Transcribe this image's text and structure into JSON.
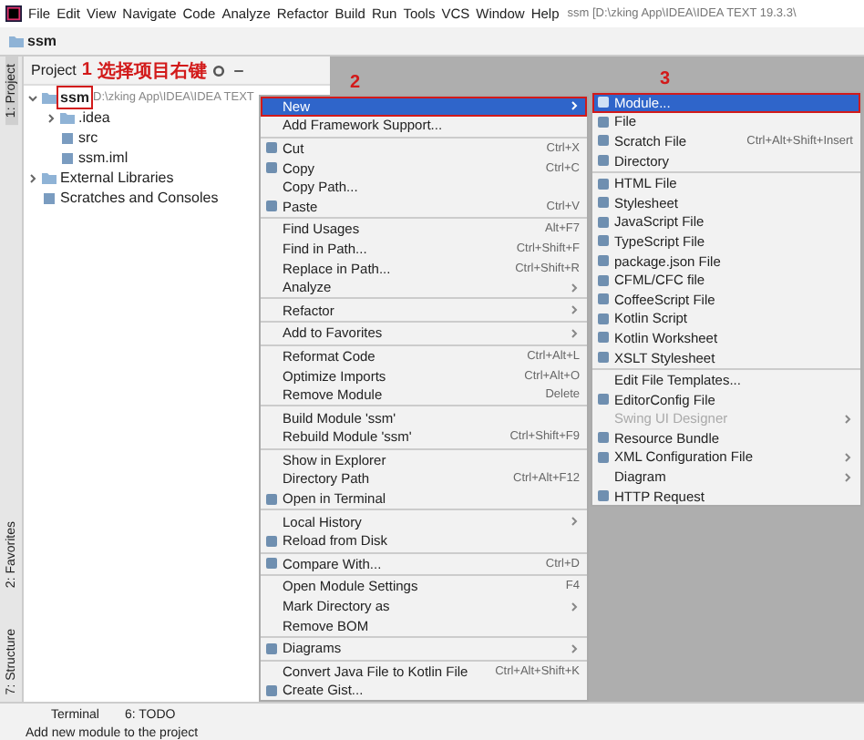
{
  "menu_bar": {
    "items": [
      "File",
      "Edit",
      "View",
      "Navigate",
      "Code",
      "Analyze",
      "Refactor",
      "Build",
      "Run",
      "Tools",
      "VCS",
      "Window",
      "Help"
    ],
    "title": "ssm [D:\\zking App\\IDEA\\IDEA TEXT 19.3.3\\"
  },
  "nav_bar": {
    "crumb": "ssm"
  },
  "side_tabs": {
    "top": [
      {
        "label": "1: Project",
        "selected": true
      }
    ],
    "bottom": [
      {
        "label": "2: Favorites",
        "selected": false
      },
      {
        "label": "7: Structure",
        "selected": false
      }
    ]
  },
  "project_panel": {
    "title": "Project",
    "tree": [
      {
        "label": "ssm",
        "path": "D:\\zking App\\IDEA\\IDEA TEXT",
        "expanded": true,
        "annotated": true,
        "children": [
          {
            "label": ".idea",
            "expanded": false
          },
          {
            "label": "src"
          },
          {
            "label": "ssm.iml"
          }
        ]
      },
      {
        "label": "External Libraries",
        "expanded": false
      },
      {
        "label": "Scratches and Consoles"
      }
    ]
  },
  "annotations": [
    {
      "label": "1",
      "note": "选择项目右键"
    },
    {
      "label": "2"
    },
    {
      "label": "3"
    }
  ],
  "context_menu": {
    "items": [
      {
        "kind": "item",
        "label": "New",
        "selected": true,
        "submenu": true,
        "annotated": true
      },
      {
        "kind": "item",
        "label": "Add Framework Support...",
        "selected": false
      },
      {
        "kind": "separator"
      },
      {
        "kind": "item",
        "label": "Cut",
        "shortcut": "Ctrl+X",
        "selected": false,
        "has_icon": true
      },
      {
        "kind": "item",
        "label": "Copy",
        "shortcut": "Ctrl+C",
        "selected": false,
        "has_icon": true
      },
      {
        "kind": "item",
        "label": "Copy Path...",
        "selected": false
      },
      {
        "kind": "item",
        "label": "Paste",
        "shortcut": "Ctrl+V",
        "selected": false,
        "has_icon": true
      },
      {
        "kind": "separator"
      },
      {
        "kind": "item",
        "label": "Find Usages",
        "shortcut": "Alt+F7",
        "selected": false
      },
      {
        "kind": "item",
        "label": "Find in Path...",
        "shortcut": "Ctrl+Shift+F",
        "selected": false
      },
      {
        "kind": "item",
        "label": "Replace in Path...",
        "shortcut": "Ctrl+Shift+R",
        "selected": false
      },
      {
        "kind": "item",
        "label": "Analyze",
        "selected": false,
        "submenu": true
      },
      {
        "kind": "separator"
      },
      {
        "kind": "item",
        "label": "Refactor",
        "selected": false,
        "submenu": true
      },
      {
        "kind": "separator"
      },
      {
        "kind": "item",
        "label": "Add to Favorites",
        "selected": false,
        "submenu": true
      },
      {
        "kind": "separator"
      },
      {
        "kind": "item",
        "label": "Reformat Code",
        "shortcut": "Ctrl+Alt+L",
        "selected": false
      },
      {
        "kind": "item",
        "label": "Optimize Imports",
        "shortcut": "Ctrl+Alt+O",
        "selected": false
      },
      {
        "kind": "item",
        "label": "Remove Module",
        "shortcut": "Delete",
        "selected": false
      },
      {
        "kind": "separator"
      },
      {
        "kind": "item",
        "label": "Build Module 'ssm'",
        "selected": false
      },
      {
        "kind": "item",
        "label": "Rebuild Module 'ssm'",
        "shortcut": "Ctrl+Shift+F9",
        "selected": false
      },
      {
        "kind": "separator"
      },
      {
        "kind": "item",
        "label": "Show in Explorer",
        "selected": false
      },
      {
        "kind": "item",
        "label": "Directory Path",
        "shortcut": "Ctrl+Alt+F12",
        "selected": false
      },
      {
        "kind": "item",
        "label": "Open in Terminal",
        "selected": false,
        "has_icon": true
      },
      {
        "kind": "separator"
      },
      {
        "kind": "item",
        "label": "Local History",
        "selected": false,
        "submenu": true
      },
      {
        "kind": "item",
        "label": "Reload from Disk",
        "selected": false,
        "has_icon": true
      },
      {
        "kind": "separator"
      },
      {
        "kind": "item",
        "label": "Compare With...",
        "shortcut": "Ctrl+D",
        "selected": false,
        "has_icon": true
      },
      {
        "kind": "separator"
      },
      {
        "kind": "item",
        "label": "Open Module Settings",
        "shortcut": "F4",
        "selected": false
      },
      {
        "kind": "item",
        "label": "Mark Directory as",
        "selected": false,
        "submenu": true
      },
      {
        "kind": "item",
        "label": "Remove BOM",
        "selected": false
      },
      {
        "kind": "separator"
      },
      {
        "kind": "item",
        "label": "Diagrams",
        "selected": false,
        "submenu": true,
        "has_icon": true
      },
      {
        "kind": "separator"
      },
      {
        "kind": "item",
        "label": "Convert Java File to Kotlin File",
        "shortcut": "Ctrl+Alt+Shift+K",
        "selected": false
      },
      {
        "kind": "item",
        "label": "Create Gist...",
        "selected": false,
        "has_icon": true
      }
    ]
  },
  "new_submenu": {
    "items": [
      {
        "kind": "item",
        "label": "Module...",
        "selected": true,
        "has_icon": true,
        "annotated": true
      },
      {
        "kind": "item",
        "label": "File",
        "selected": false,
        "has_icon": true
      },
      {
        "kind": "item",
        "label": "Scratch File",
        "shortcut": "Ctrl+Alt+Shift+Insert",
        "selected": false,
        "has_icon": true
      },
      {
        "kind": "item",
        "label": "Directory",
        "selected": false,
        "has_icon": true
      },
      {
        "kind": "separator"
      },
      {
        "kind": "item",
        "label": "HTML File",
        "selected": false,
        "has_icon": true
      },
      {
        "kind": "item",
        "label": "Stylesheet",
        "selected": false,
        "has_icon": true
      },
      {
        "kind": "item",
        "label": "JavaScript File",
        "selected": false,
        "has_icon": true
      },
      {
        "kind": "item",
        "label": "TypeScript File",
        "selected": false,
        "has_icon": true
      },
      {
        "kind": "item",
        "label": "package.json File",
        "selected": false,
        "has_icon": true
      },
      {
        "kind": "item",
        "label": "CFML/CFC file",
        "selected": false,
        "has_icon": true
      },
      {
        "kind": "item",
        "label": "CoffeeScript File",
        "selected": false,
        "has_icon": true
      },
      {
        "kind": "item",
        "label": "Kotlin Script",
        "selected": false,
        "has_icon": true
      },
      {
        "kind": "item",
        "label": "Kotlin Worksheet",
        "selected": false,
        "has_icon": true
      },
      {
        "kind": "item",
        "label": "XSLT Stylesheet",
        "selected": false,
        "has_icon": true
      },
      {
        "kind": "separator"
      },
      {
        "kind": "item",
        "label": "Edit File Templates...",
        "selected": false
      },
      {
        "kind": "item",
        "label": "EditorConfig File",
        "selected": false,
        "has_icon": true
      },
      {
        "kind": "item",
        "label": "Swing UI Designer",
        "selected": false,
        "disabled": true,
        "submenu": true
      },
      {
        "kind": "item",
        "label": "Resource Bundle",
        "selected": false,
        "has_icon": true
      },
      {
        "kind": "item",
        "label": "XML Configuration File",
        "selected": false,
        "has_icon": true,
        "submenu": true
      },
      {
        "kind": "item",
        "label": "Diagram",
        "selected": false,
        "submenu": true
      },
      {
        "kind": "item",
        "label": "HTTP Request",
        "selected": false,
        "has_icon": true
      }
    ]
  },
  "bottom_tabs": [
    "Terminal",
    "6: TODO"
  ],
  "status_bar": {
    "text": "Add new module to the project"
  }
}
